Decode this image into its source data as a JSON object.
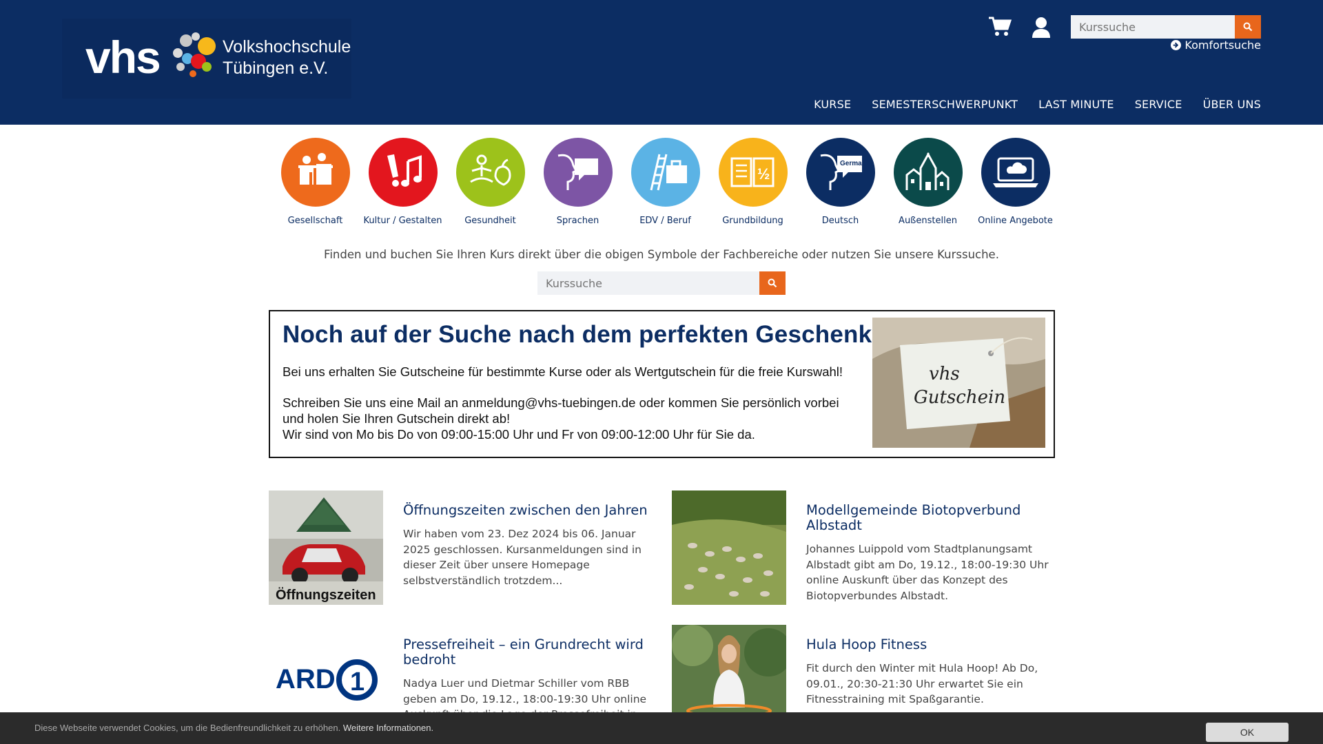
{
  "header": {
    "logo_text": "vhs",
    "logo_name_line1": "Volkshochschule",
    "logo_name_line2": "Tübingen e.V.",
    "search_placeholder": "Kurssuche",
    "komfort_label": "Komfortsuche",
    "nav": [
      "KURSE",
      "SEMESTERSCHWERPUNKT",
      "LAST MINUTE",
      "SERVICE",
      "ÜBER UNS"
    ]
  },
  "categories": [
    {
      "label": "Gesellschaft",
      "color": "#ee6a1c",
      "icon": "people-icon"
    },
    {
      "label": "Kultur / Gestalten",
      "color": "#e3161e",
      "icon": "brush-music-icon"
    },
    {
      "label": "Gesundheit",
      "color": "#9dc21b",
      "icon": "meditation-apple-icon"
    },
    {
      "label": "Sprachen",
      "color": "#7d55a5",
      "icon": "speech-head-icon"
    },
    {
      "label": "EDV / Beruf",
      "color": "#5bb3e5",
      "icon": "ladder-briefcase-icon"
    },
    {
      "label": "Grundbildung",
      "color": "#f8b31b",
      "icon": "book-half-icon"
    },
    {
      "label": "Deutsch",
      "color": "#0c2d63",
      "icon": "speech-german-icon",
      "icon_text": "German"
    },
    {
      "label": "Außenstellen",
      "color": "#0b4a4a",
      "icon": "village-icon"
    },
    {
      "label": "Online Angebote",
      "color": "#0c2d63",
      "icon": "laptop-cloud-icon"
    }
  ],
  "intro_text": "Finden und buchen Sie Ihren Kurs direkt über die obigen Symbole der Fachbereiche oder nutzen Sie unsere Kurssuche.",
  "mid_search_placeholder": "Kurssuche",
  "banner": {
    "title": "Noch auf der Suche nach dem perfekten Geschenk?",
    "line1": "Bei uns erhalten Sie Gutscheine für bestimmte Kurse oder als Wertgutschein für die freie Kurswahl!",
    "line2": "Schreiben Sie uns eine Mail an anmeldung@vhs-tuebingen.de oder kommen Sie persönlich vorbei und holen Sie Ihren Gutschein direkt ab!",
    "line3": "Wir sind von Mo bis Do von 09:00-15:00 Uhr und Fr von 09:00-12:00 Uhr für Sie da.",
    "image_text_1": "vhs",
    "image_text_2": "Gutschein"
  },
  "news": [
    {
      "title": "Öffnungszeiten zwischen den Jahren",
      "text": "Wir haben vom 23. Dez 2024 bis 06. Januar 2025 geschlossen. Kursanmeldungen sind in dieser Zeit über unsere Homepage selbstverständlich trotzdem...",
      "image_caption": "Öffnungszeiten"
    },
    {
      "title": "Modellgemeinde Biotopverbund Albstadt",
      "text": "Johannes Luippold vom Stadtplanungsamt Albstadt gibt am Do, 19.12., 18:00-19:30 Uhr online Auskunft über das Konzept des Biotopverbundes Albstadt."
    },
    {
      "title": "Pressefreiheit – ein Grundrecht wird bedroht",
      "text": "Nadya Luer und Dietmar Schiller vom RBB geben am Do, 19.12., 18:00-19:30 Uhr online Auskunft über die Lage der Pressefreiheit in...",
      "image_caption": "ARD"
    },
    {
      "title": "Hula Hoop Fitness",
      "text": "Fit durch den Winter mit Hula Hoop! Ab Do, 09.01., 20:30-21:30 Uhr erwartet Sie ein Fitnesstraining mit Spaßgarantie."
    }
  ],
  "cookie": {
    "text": "Diese Webseite verwendet Cookies, um die Bedienfreundlichkeit zu erhöhen.",
    "link": "Weitere Informationen.",
    "ok": "OK"
  }
}
